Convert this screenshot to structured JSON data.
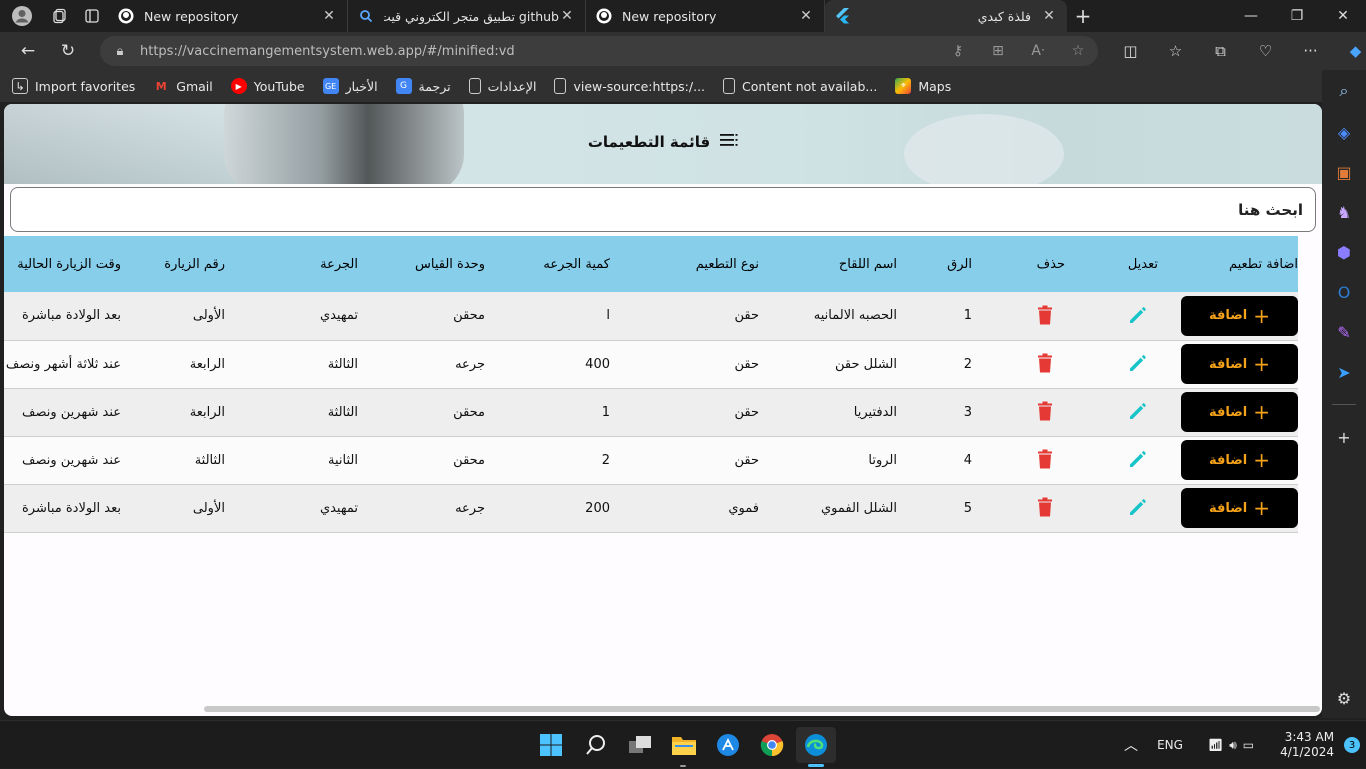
{
  "browser": {
    "tabs": [
      {
        "title": "New repository",
        "icon": "github-icon"
      },
      {
        "title": "github تطبيق متجر الكتروني قيت هب",
        "icon": "search-icon"
      },
      {
        "title": "New repository",
        "icon": "github-icon"
      },
      {
        "title": "فلذة كبدي",
        "icon": "flutter-icon"
      }
    ],
    "url": "https://vaccinemangementsystem.web.app/#/minified:vd",
    "bookmarks": [
      {
        "label": "Import favorites",
        "icon": "import-icon"
      },
      {
        "label": "Gmail",
        "icon": "gmail-icon"
      },
      {
        "label": "YouTube",
        "icon": "youtube-icon"
      },
      {
        "label": "الأخبار",
        "icon": "news-icon"
      },
      {
        "label": "ترجمة",
        "icon": "translate-icon"
      },
      {
        "label": "الإعدادات",
        "icon": "page-icon"
      },
      {
        "label": "view-source:https:/...",
        "icon": "page-icon"
      },
      {
        "label": "Content not availab...",
        "icon": "page-icon"
      },
      {
        "label": "Maps",
        "icon": "maps-icon"
      }
    ]
  },
  "page": {
    "title": "قائمة التطعيمات",
    "search_placeholder": "ابحث هنا",
    "columns": [
      "اضافة تطعيم",
      "تعديل",
      "حذف",
      "الرق",
      "اسم اللقاح",
      "نوع التطعيم",
      "كمية الجرعه",
      "وحدة القياس",
      "الجرعة",
      "رقم الزيارة",
      "وقت الزيارة الحالية"
    ],
    "add_button_label": "اضافة",
    "rows": [
      {
        "num": "1",
        "name": "الحصبه الالمانيه",
        "type": "حقن",
        "dose_qty": "ا",
        "unit": "محقن",
        "dose": "تمهيدي",
        "visit_no": "الأولى",
        "visit_time": "بعد الولادة مباشرة"
      },
      {
        "num": "2",
        "name": "الشلل حقن",
        "type": "حقن",
        "dose_qty": "400",
        "unit": "جرعه",
        "dose": "الثالثة",
        "visit_no": "الرابعة",
        "visit_time": "عند ثلاثة أشهر ونصف"
      },
      {
        "num": "3",
        "name": "الدفتيريا",
        "type": "حقن",
        "dose_qty": "1",
        "unit": "محقن",
        "dose": "الثالثة",
        "visit_no": "الرابعة",
        "visit_time": "عند شهرين ونصف"
      },
      {
        "num": "4",
        "name": "الروتا",
        "type": "حقن",
        "dose_qty": "2",
        "unit": "محقن",
        "dose": "الثانية",
        "visit_no": "الثالثة",
        "visit_time": "عند شهرين ونصف"
      },
      {
        "num": "5",
        "name": "الشلل الفموي",
        "type": "فموي",
        "dose_qty": "200",
        "unit": "جرعه",
        "dose": "تمهيدي",
        "visit_no": "الأولى",
        "visit_time": "بعد الولادة مباشرة"
      }
    ]
  },
  "taskbar": {
    "lang": "ENG",
    "time": "3:43 AM",
    "date": "4/1/2024",
    "notifications": "3"
  },
  "colors": {
    "header_row": "#87ceeb",
    "add_button_bg": "#000000",
    "add_button_text": "#f7a21b",
    "edit_icon": "#17c4c7",
    "delete_icon": "#e53935"
  }
}
